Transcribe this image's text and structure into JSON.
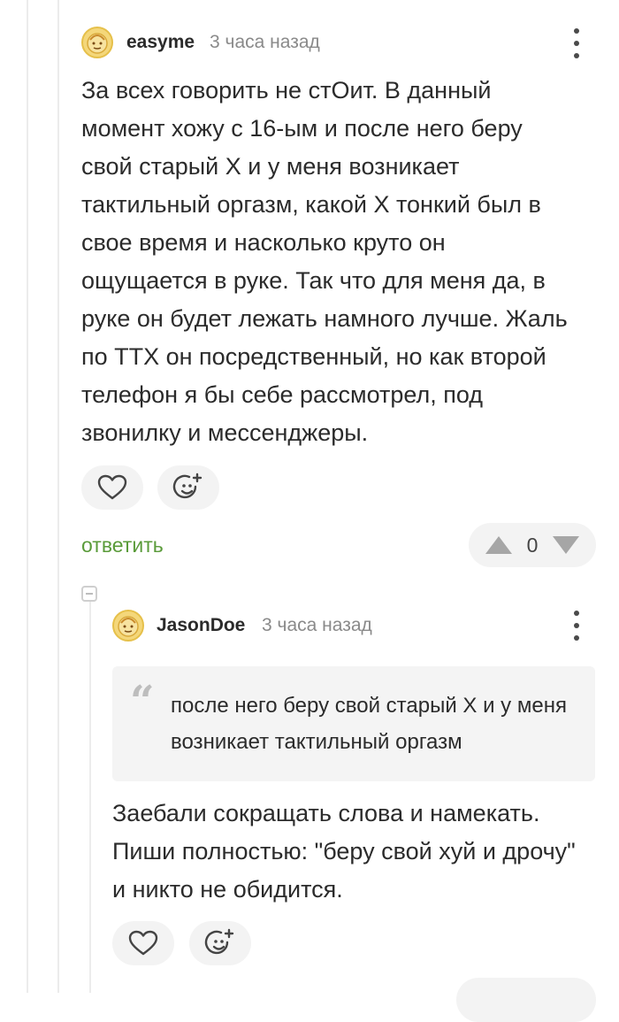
{
  "comments": [
    {
      "author": "easyme",
      "time": "3 часа назад",
      "avatar_icon": "avatar-face-icon",
      "text": "За всех говорить не стОит. В данный момент хожу с 16-ым и после него беру свой старый X и у меня возникает тактильный оргазм, какой X тонкий был в свое время и насколько круто он ощущается в руке. Так что для меня да, в руке он будет лежать намного лучше. Жаль по ТТХ он посредственный, но как второй телефон я бы себе рассмотрел, под звонилку и мессенджеры.",
      "reply_label": "ответить",
      "rating": "0"
    },
    {
      "author": "JasonDoe",
      "time": "3 часа назад",
      "avatar_icon": "avatar-face-icon",
      "quote": "после него беру свой старый X и у меня возникает тактильный оргазм",
      "text": "Заебали сокращать слова и намекать. Пиши полностью: \"беру свой хуй и дрочу\" и никто не обидится."
    }
  ],
  "icons": {
    "like": "heart-icon",
    "reaction": "smiley-add-icon",
    "upvote": "triangle-up-icon",
    "downvote": "triangle-down-icon",
    "menu": "more-vertical-icon",
    "quote": "quote-icon",
    "collapse": "collapse-minus-icon"
  },
  "colors": {
    "accent_green": "#5a9b3a",
    "pill_bg": "#f3f3f3",
    "vote_arrow": "#a6a6a6"
  }
}
